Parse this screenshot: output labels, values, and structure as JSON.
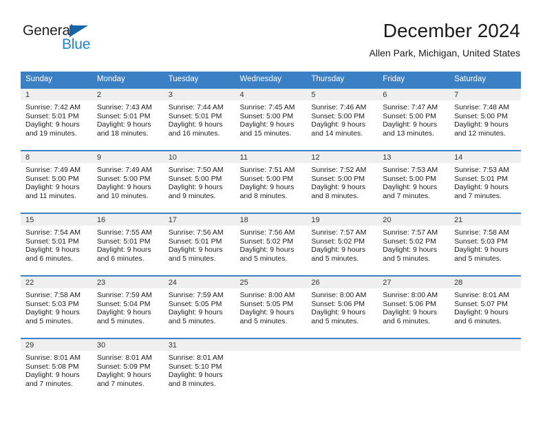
{
  "brand": {
    "name_part1": "General",
    "name_part2": "Blue",
    "accent_color": "#1f82d2",
    "triangle_color": "#1565a8"
  },
  "header": {
    "title": "December 2024",
    "subtitle": "Allen Park, Michigan, United States"
  },
  "calendar": {
    "header_bg": "#3b7fc4",
    "daynum_bg": "#efefef",
    "weekdays": [
      "Sunday",
      "Monday",
      "Tuesday",
      "Wednesday",
      "Thursday",
      "Friday",
      "Saturday"
    ],
    "weeks": [
      [
        {
          "day": "1",
          "sunrise": "Sunrise: 7:42 AM",
          "sunset": "Sunset: 5:01 PM",
          "daylight": "Daylight: 9 hours and 19 minutes."
        },
        {
          "day": "2",
          "sunrise": "Sunrise: 7:43 AM",
          "sunset": "Sunset: 5:01 PM",
          "daylight": "Daylight: 9 hours and 18 minutes."
        },
        {
          "day": "3",
          "sunrise": "Sunrise: 7:44 AM",
          "sunset": "Sunset: 5:01 PM",
          "daylight": "Daylight: 9 hours and 16 minutes."
        },
        {
          "day": "4",
          "sunrise": "Sunrise: 7:45 AM",
          "sunset": "Sunset: 5:00 PM",
          "daylight": "Daylight: 9 hours and 15 minutes."
        },
        {
          "day": "5",
          "sunrise": "Sunrise: 7:46 AM",
          "sunset": "Sunset: 5:00 PM",
          "daylight": "Daylight: 9 hours and 14 minutes."
        },
        {
          "day": "6",
          "sunrise": "Sunrise: 7:47 AM",
          "sunset": "Sunset: 5:00 PM",
          "daylight": "Daylight: 9 hours and 13 minutes."
        },
        {
          "day": "7",
          "sunrise": "Sunrise: 7:48 AM",
          "sunset": "Sunset: 5:00 PM",
          "daylight": "Daylight: 9 hours and 12 minutes."
        }
      ],
      [
        {
          "day": "8",
          "sunrise": "Sunrise: 7:49 AM",
          "sunset": "Sunset: 5:00 PM",
          "daylight": "Daylight: 9 hours and 11 minutes."
        },
        {
          "day": "9",
          "sunrise": "Sunrise: 7:49 AM",
          "sunset": "Sunset: 5:00 PM",
          "daylight": "Daylight: 9 hours and 10 minutes."
        },
        {
          "day": "10",
          "sunrise": "Sunrise: 7:50 AM",
          "sunset": "Sunset: 5:00 PM",
          "daylight": "Daylight: 9 hours and 9 minutes."
        },
        {
          "day": "11",
          "sunrise": "Sunrise: 7:51 AM",
          "sunset": "Sunset: 5:00 PM",
          "daylight": "Daylight: 9 hours and 8 minutes."
        },
        {
          "day": "12",
          "sunrise": "Sunrise: 7:52 AM",
          "sunset": "Sunset: 5:00 PM",
          "daylight": "Daylight: 9 hours and 8 minutes."
        },
        {
          "day": "13",
          "sunrise": "Sunrise: 7:53 AM",
          "sunset": "Sunset: 5:00 PM",
          "daylight": "Daylight: 9 hours and 7 minutes."
        },
        {
          "day": "14",
          "sunrise": "Sunrise: 7:53 AM",
          "sunset": "Sunset: 5:01 PM",
          "daylight": "Daylight: 9 hours and 7 minutes."
        }
      ],
      [
        {
          "day": "15",
          "sunrise": "Sunrise: 7:54 AM",
          "sunset": "Sunset: 5:01 PM",
          "daylight": "Daylight: 9 hours and 6 minutes."
        },
        {
          "day": "16",
          "sunrise": "Sunrise: 7:55 AM",
          "sunset": "Sunset: 5:01 PM",
          "daylight": "Daylight: 9 hours and 6 minutes."
        },
        {
          "day": "17",
          "sunrise": "Sunrise: 7:56 AM",
          "sunset": "Sunset: 5:01 PM",
          "daylight": "Daylight: 9 hours and 5 minutes."
        },
        {
          "day": "18",
          "sunrise": "Sunrise: 7:56 AM",
          "sunset": "Sunset: 5:02 PM",
          "daylight": "Daylight: 9 hours and 5 minutes."
        },
        {
          "day": "19",
          "sunrise": "Sunrise: 7:57 AM",
          "sunset": "Sunset: 5:02 PM",
          "daylight": "Daylight: 9 hours and 5 minutes."
        },
        {
          "day": "20",
          "sunrise": "Sunrise: 7:57 AM",
          "sunset": "Sunset: 5:02 PM",
          "daylight": "Daylight: 9 hours and 5 minutes."
        },
        {
          "day": "21",
          "sunrise": "Sunrise: 7:58 AM",
          "sunset": "Sunset: 5:03 PM",
          "daylight": "Daylight: 9 hours and 5 minutes."
        }
      ],
      [
        {
          "day": "22",
          "sunrise": "Sunrise: 7:58 AM",
          "sunset": "Sunset: 5:03 PM",
          "daylight": "Daylight: 9 hours and 5 minutes."
        },
        {
          "day": "23",
          "sunrise": "Sunrise: 7:59 AM",
          "sunset": "Sunset: 5:04 PM",
          "daylight": "Daylight: 9 hours and 5 minutes."
        },
        {
          "day": "24",
          "sunrise": "Sunrise: 7:59 AM",
          "sunset": "Sunset: 5:05 PM",
          "daylight": "Daylight: 9 hours and 5 minutes."
        },
        {
          "day": "25",
          "sunrise": "Sunrise: 8:00 AM",
          "sunset": "Sunset: 5:05 PM",
          "daylight": "Daylight: 9 hours and 5 minutes."
        },
        {
          "day": "26",
          "sunrise": "Sunrise: 8:00 AM",
          "sunset": "Sunset: 5:06 PM",
          "daylight": "Daylight: 9 hours and 5 minutes."
        },
        {
          "day": "27",
          "sunrise": "Sunrise: 8:00 AM",
          "sunset": "Sunset: 5:06 PM",
          "daylight": "Daylight: 9 hours and 6 minutes."
        },
        {
          "day": "28",
          "sunrise": "Sunrise: 8:01 AM",
          "sunset": "Sunset: 5:07 PM",
          "daylight": "Daylight: 9 hours and 6 minutes."
        }
      ],
      [
        {
          "day": "29",
          "sunrise": "Sunrise: 8:01 AM",
          "sunset": "Sunset: 5:08 PM",
          "daylight": "Daylight: 9 hours and 7 minutes."
        },
        {
          "day": "30",
          "sunrise": "Sunrise: 8:01 AM",
          "sunset": "Sunset: 5:09 PM",
          "daylight": "Daylight: 9 hours and 7 minutes."
        },
        {
          "day": "31",
          "sunrise": "Sunrise: 8:01 AM",
          "sunset": "Sunset: 5:10 PM",
          "daylight": "Daylight: 9 hours and 8 minutes."
        },
        {
          "day": "",
          "sunrise": "",
          "sunset": "",
          "daylight": ""
        },
        {
          "day": "",
          "sunrise": "",
          "sunset": "",
          "daylight": ""
        },
        {
          "day": "",
          "sunrise": "",
          "sunset": "",
          "daylight": ""
        },
        {
          "day": "",
          "sunrise": "",
          "sunset": "",
          "daylight": ""
        }
      ]
    ]
  }
}
